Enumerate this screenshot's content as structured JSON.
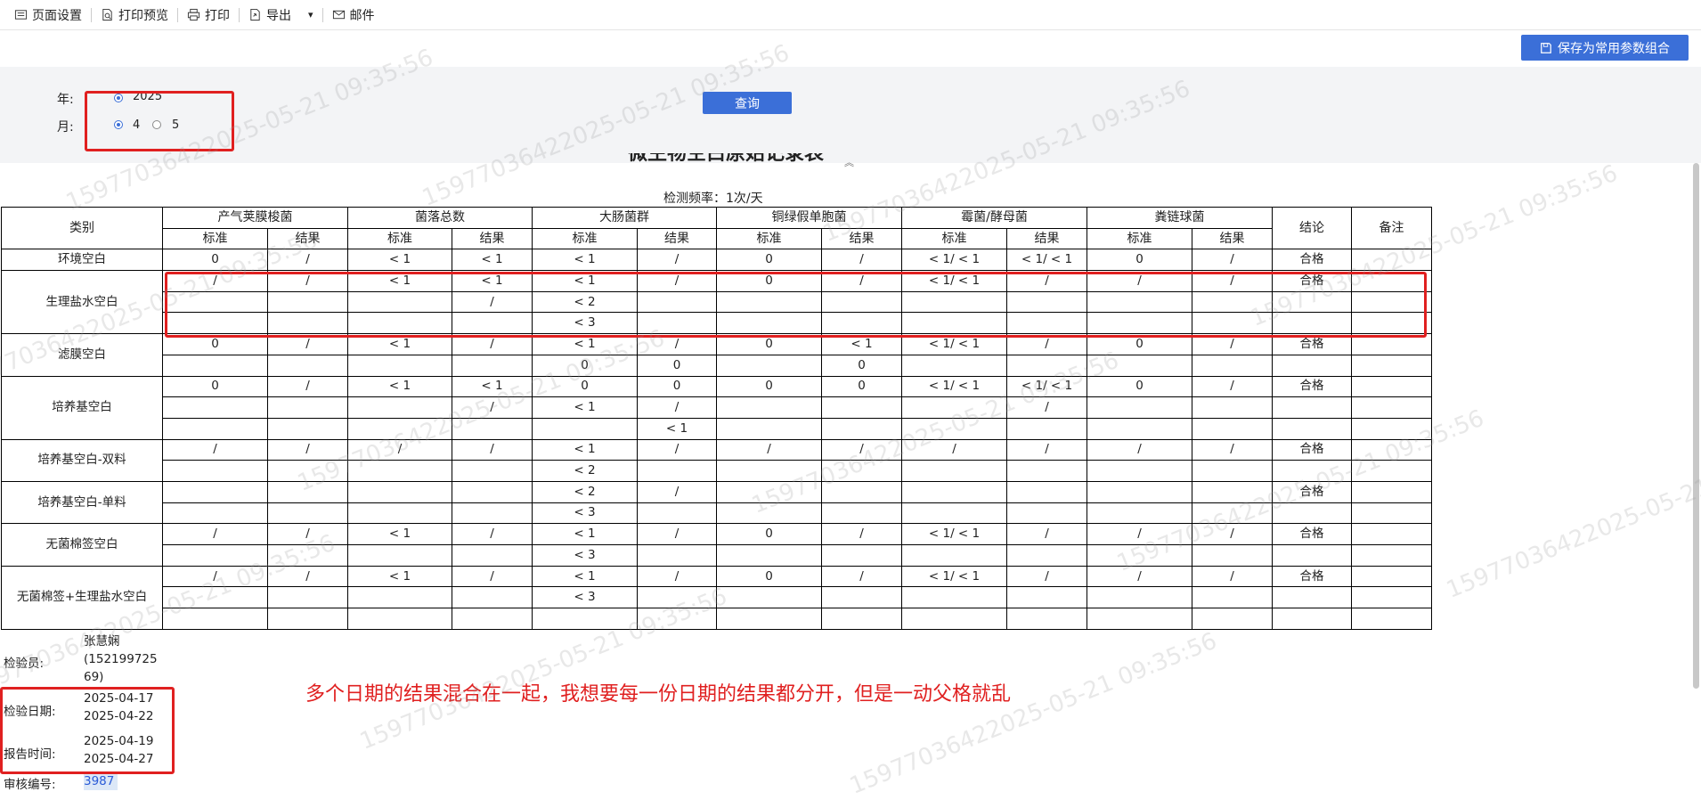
{
  "toolbar": {
    "items": [
      {
        "label": "页面设置",
        "icon": "page-setup-icon"
      },
      {
        "label": "打印预览",
        "icon": "print-preview-icon"
      },
      {
        "label": "打印",
        "icon": "printer-icon"
      },
      {
        "label": "导出",
        "icon": "export-icon"
      },
      {
        "label": "邮件",
        "icon": "mail-icon"
      }
    ],
    "export_arrow": "▾",
    "save_button": "保存为常用参数组合"
  },
  "params": {
    "year_label": "年:",
    "year_option": "2025",
    "month_label": "月:",
    "month_options": [
      "4",
      "5"
    ],
    "month_selected": "4",
    "query_button": "查询",
    "collapse_glyph": "︽"
  },
  "report": {
    "title": "微生物空白原始记录表",
    "frequency": "检测频率：1次/天",
    "header": {
      "category": "类别",
      "groups": [
        "产气荚膜梭菌",
        "菌落总数",
        "大肠菌群",
        "铜绿假单胞菌",
        "霉菌/酵母菌",
        "粪链球菌"
      ],
      "sub_std": "标准",
      "sub_res": "结果",
      "conclusion": "结论",
      "remark": "备注"
    },
    "rows": [
      {
        "category": "环境空白",
        "lines": [
          [
            "0",
            "/",
            "< 1",
            "< 1",
            "< 1",
            "/",
            "0",
            "/",
            "< 1/ < 1",
            "< 1/ < 1",
            "0",
            "/",
            "合格",
            ""
          ]
        ]
      },
      {
        "category": "生理盐水空白",
        "lines": [
          [
            "/",
            "/",
            "< 1",
            "< 1",
            "< 1",
            "/",
            "0",
            "/",
            "< 1/ < 1",
            "/",
            "/",
            "/",
            "合格",
            ""
          ],
          [
            "",
            "",
            "",
            "/",
            "< 2",
            "",
            "",
            "",
            "",
            "",
            "",
            "",
            "",
            ""
          ],
          [
            "",
            "",
            "",
            "",
            "< 3",
            "",
            "",
            "",
            "",
            "",
            "",
            "",
            "",
            ""
          ]
        ]
      },
      {
        "category": "滤膜空白",
        "lines": [
          [
            "0",
            "/",
            "< 1",
            "/",
            "< 1",
            "/",
            "0",
            "< 1",
            "< 1/ < 1",
            "/",
            "0",
            "/",
            "合格",
            ""
          ],
          [
            "",
            "",
            "",
            "",
            "0",
            "0",
            "",
            "0",
            "",
            "",
            "",
            "",
            "",
            ""
          ]
        ]
      },
      {
        "category": "培养基空白",
        "lines": [
          [
            "0",
            "/",
            "< 1",
            "< 1",
            "0",
            "0",
            "0",
            "0",
            "< 1/ < 1",
            "< 1/ < 1",
            "0",
            "/",
            "合格",
            ""
          ],
          [
            "",
            "",
            "",
            "/",
            "< 1",
            "/",
            "",
            "",
            "",
            "/",
            "",
            "",
            "",
            ""
          ],
          [
            "",
            "",
            "",
            "",
            "",
            "< 1",
            "",
            "",
            "",
            "",
            "",
            "",
            "",
            ""
          ]
        ]
      },
      {
        "category": "培养基空白-双料",
        "lines": [
          [
            "/",
            "/",
            "/",
            "/",
            "< 1",
            "/",
            "/",
            "/",
            "/",
            "/",
            "/",
            "/",
            "合格",
            ""
          ],
          [
            "",
            "",
            "",
            "",
            "< 2",
            "",
            "",
            "",
            "",
            "",
            "",
            "",
            "",
            ""
          ]
        ]
      },
      {
        "category": "培养基空白-单料",
        "lines": [
          [
            "",
            "",
            "",
            "",
            "< 2",
            "/",
            "",
            "",
            "",
            "",
            "",
            "",
            "合格",
            ""
          ],
          [
            "",
            "",
            "",
            "",
            "< 3",
            "",
            "",
            "",
            "",
            "",
            "",
            "",
            "",
            ""
          ]
        ]
      },
      {
        "category": "无菌棉签空白",
        "lines": [
          [
            "/",
            "/",
            "< 1",
            "/",
            "< 1",
            "/",
            "0",
            "/",
            "< 1/ < 1",
            "/",
            "/",
            "/",
            "合格",
            ""
          ],
          [
            "",
            "",
            "",
            "",
            "< 3",
            "",
            "",
            "",
            "",
            "",
            "",
            "",
            "",
            ""
          ]
        ]
      },
      {
        "category": "无菌棉签+生理盐水空白",
        "lines": [
          [
            "/",
            "/",
            "< 1",
            "/",
            "< 1",
            "/",
            "0",
            "/",
            "< 1/ < 1",
            "/",
            "/",
            "/",
            "合格",
            ""
          ],
          [
            "",
            "",
            "",
            "",
            "< 3",
            "",
            "",
            "",
            "",
            "",
            "",
            "",
            "",
            ""
          ],
          [
            "",
            "",
            "",
            "",
            "",
            "",
            "",
            "",
            "",
            "",
            "",
            "",
            "",
            ""
          ]
        ]
      }
    ],
    "footer": {
      "inspector_label": "检验员:",
      "inspector_value": "张慧娴 (15219972569)",
      "inspector_lines": [
        "张慧娴",
        "(152199725",
        "69)"
      ],
      "date_label": "检验日期:",
      "dates": [
        "2025-04-17",
        "2025-04-22"
      ],
      "report_time_label": "报告时间:",
      "report_times": [
        "2025-04-19",
        "2025-04-27"
      ],
      "review_label": "审核编号:",
      "review_value": "3987"
    }
  },
  "annotation": "多个日期的结果混合在一起，我想要每一份日期的结果都分开，但是一动父格就乱",
  "watermark": "15977036422025-05-21 09:35:56",
  "colors": {
    "accent": "#3b6fd8",
    "annotation_red": "#e02020"
  }
}
